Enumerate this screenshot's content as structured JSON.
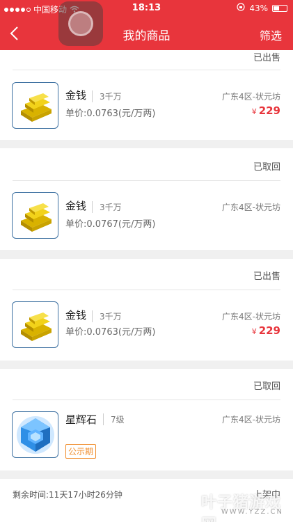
{
  "statusbar": {
    "carrier": "中国移动",
    "time": "18:13",
    "battery": "43%",
    "battery_level": 0.43
  },
  "nav": {
    "title": "我的商品",
    "filter_label": "筛选"
  },
  "items": [
    {
      "status": "已出售"
    },
    {
      "name": "金钱",
      "quantity": "3千万",
      "unit_price": "单价:0.0763(元/万两)",
      "server": "广东4区-状元坊",
      "price_symbol": "¥",
      "price": "229",
      "status": "已取回"
    },
    {
      "name": "金钱",
      "quantity": "3千万",
      "unit_price": "单价:0.0767(元/万两)",
      "server": "广东4区-状元坊",
      "status": "已出售"
    },
    {
      "name": "金钱",
      "quantity": "3千万",
      "unit_price": "单价:0.0763(元/万两)",
      "server": "广东4区-状元坊",
      "price_symbol": "¥",
      "price": "229",
      "status": "已取回"
    },
    {
      "name": "星辉石",
      "quantity": "7级",
      "badge": "公示期",
      "server": "广东4区-状元坊"
    }
  ],
  "bottom": {
    "remaining": "剩余时间:11天17小时26分钟",
    "status": "上架中"
  },
  "watermark": {
    "text": "叶子猪游戏网",
    "url": "WWW.YZZ.CN"
  },
  "colors": {
    "accent": "#e8353c",
    "badge": "#f08c2a"
  }
}
